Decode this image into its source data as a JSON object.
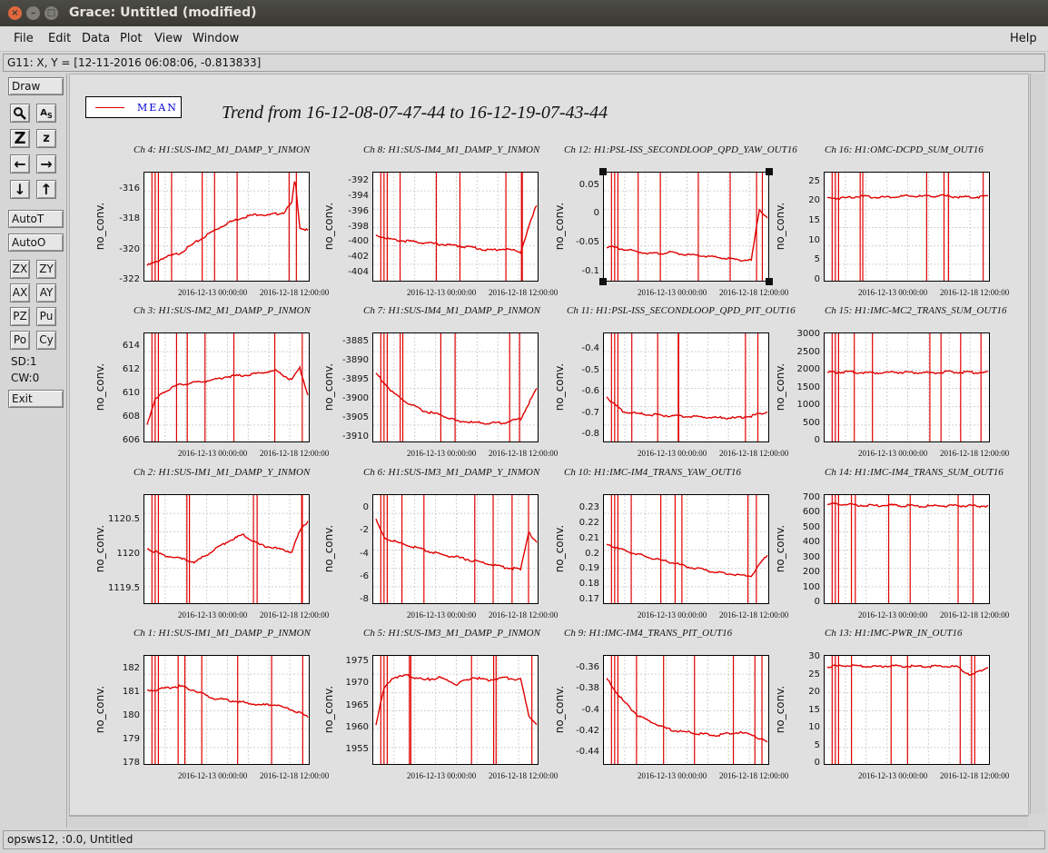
{
  "window": {
    "title": "Grace: Untitled (modified)"
  },
  "menu": {
    "file": "File",
    "edit": "Edit",
    "data": "Data",
    "plot": "Plot",
    "view": "View",
    "window": "Window",
    "help": "Help"
  },
  "locator": "G11: X, Y = [12-11-2016 06:08:06, -0.813833]",
  "toolbar": {
    "draw": "Draw",
    "autot": "AutoT",
    "autoo": "AutoO",
    "zx": "ZX",
    "zy": "ZY",
    "ax": "AX",
    "ay": "AY",
    "pz": "PZ",
    "pu": "Pu",
    "po": "Po",
    "cy": "Cy",
    "sd": "SD:1",
    "cw": "CW:0",
    "exit": "Exit",
    "icons": [
      "magnifier-icon",
      "text-as-icon",
      "zoom-z-icon",
      "zoom-z-small-icon",
      "arrow-left-icon",
      "arrow-right-icon",
      "arrow-down-icon",
      "arrow-up-icon"
    ]
  },
  "status": "opsws12, :0.0, Untitled",
  "legend": {
    "label": "MEAN",
    "color": "#e00000"
  },
  "main_title": "Trend from 16-12-08-07-47-44 to 16-12-19-07-43-44",
  "xticks": [
    "2016-12-13 00:00:00",
    "2016-12-18 12:00:00"
  ],
  "ylabel": "no_conv.",
  "ylabel_alt": "no_conv.",
  "chart_data": [
    {
      "type": "line",
      "title": "Ch 4: H1:SUS-IM2_M1_DAMP_Y_INMON",
      "yticks": [
        "-316",
        "-318",
        "-320",
        "-322"
      ],
      "ylim": [
        -322,
        -315
      ],
      "x": [
        0,
        0.05,
        0.1,
        0.2,
        0.3,
        0.4,
        0.5,
        0.6,
        0.7,
        0.75,
        0.8,
        0.85,
        0.9,
        0.92,
        0.95,
        1.0
      ],
      "y": [
        -321,
        -320.8,
        -320.5,
        -320.2,
        -319.5,
        -318.8,
        -318.2,
        -317.8,
        -317.6,
        -317.7,
        -317.6,
        -317.5,
        -316.9,
        -315.2,
        -318.5,
        -318.7
      ]
    },
    {
      "type": "line",
      "title": "Ch 8: H1:SUS-IM4_M1_DAMP_Y_INMON",
      "yticks": [
        "-392",
        "-394",
        "-396",
        "-398",
        "-400",
        "-402",
        "-404"
      ],
      "ylim": [
        -405,
        -391
      ],
      "x": [
        0,
        0.1,
        0.2,
        0.3,
        0.4,
        0.5,
        0.6,
        0.7,
        0.8,
        0.9,
        0.95,
        1.0
      ],
      "y": [
        -399,
        -399.6,
        -399.8,
        -400,
        -400.2,
        -400.4,
        -400.6,
        -401,
        -400.8,
        -401.2,
        -398,
        -395
      ]
    },
    {
      "type": "line",
      "title": "Ch 12: H1:PSL-ISS_SECONDLOOP_QPD_YAW_OUT16",
      "yticks": [
        "0.05",
        "0",
        "-0.05",
        "-0.1"
      ],
      "ylim": [
        -0.115,
        0.07
      ],
      "x": [
        0,
        0.1,
        0.2,
        0.3,
        0.4,
        0.5,
        0.6,
        0.7,
        0.8,
        0.9,
        0.95,
        1.0
      ],
      "y": [
        -0.055,
        -0.06,
        -0.065,
        -0.068,
        -0.066,
        -0.07,
        -0.072,
        -0.075,
        -0.078,
        -0.08,
        0.01,
        -0.005
      ]
    },
    {
      "type": "line",
      "title": "Ch 16: H1:OMC-DCPD_SUM_OUT16",
      "yticks": [
        "25",
        "20",
        "15",
        "10",
        "5",
        "0"
      ],
      "ylim": [
        0,
        27
      ],
      "x": [
        0,
        0.1,
        0.2,
        0.3,
        0.4,
        0.5,
        0.6,
        0.7,
        0.8,
        0.9,
        1.0
      ],
      "y": [
        21,
        21,
        21.5,
        21.2,
        21.3,
        21.5,
        21.4,
        21.6,
        21.3,
        21.2,
        21.5
      ]
    },
    {
      "type": "line",
      "title": "Ch 3: H1:SUS-IM2_M1_DAMP_P_INMON",
      "yticks": [
        "614",
        "612",
        "610",
        "608",
        "606"
      ],
      "ylim": [
        606,
        615
      ],
      "x": [
        0,
        0.05,
        0.1,
        0.2,
        0.3,
        0.4,
        0.5,
        0.6,
        0.7,
        0.8,
        0.9,
        0.95,
        1.0
      ],
      "y": [
        607.5,
        609.5,
        610.2,
        610.8,
        611,
        611.2,
        611.5,
        611.6,
        611.8,
        612,
        611.2,
        612.2,
        610
      ]
    },
    {
      "type": "line",
      "title": "Ch 7: H1:SUS-IM4_M1_DAMP_P_INMON",
      "yticks": [
        "-3885",
        "-3890",
        "-3895",
        "-3900",
        "-3905",
        "-3910"
      ],
      "ylim": [
        -3911,
        -3883
      ],
      "x": [
        0,
        0.1,
        0.2,
        0.3,
        0.4,
        0.5,
        0.6,
        0.7,
        0.8,
        0.9,
        1.0
      ],
      "y": [
        -3893,
        -3898,
        -3901,
        -3903,
        -3904,
        -3905.5,
        -3906,
        -3906.2,
        -3906,
        -3905,
        -3897
      ]
    },
    {
      "type": "line",
      "title": "Ch 11: H1:PSL-ISS_SECONDLOOP_QPD_PIT_OUT16",
      "yticks": [
        "-0.4",
        "-0.5",
        "-0.6",
        "-0.7",
        "-0.8"
      ],
      "ylim": [
        -0.83,
        -0.33
      ],
      "x": [
        0,
        0.1,
        0.2,
        0.3,
        0.4,
        0.5,
        0.6,
        0.7,
        0.8,
        0.9,
        1.0
      ],
      "y": [
        -0.62,
        -0.69,
        -0.7,
        -0.705,
        -0.71,
        -0.712,
        -0.715,
        -0.718,
        -0.72,
        -0.71,
        -0.69
      ]
    },
    {
      "type": "line",
      "title": "Ch 15: H1:IMC-MC2_TRANS_SUM_OUT16",
      "yticks": [
        "3000",
        "2500",
        "2000",
        "1500",
        "1000",
        "500",
        "0"
      ],
      "ylim": [
        0,
        3000
      ],
      "x": [
        0,
        0.1,
        0.2,
        0.3,
        0.4,
        0.5,
        0.6,
        0.7,
        0.8,
        0.9,
        1.0
      ],
      "y": [
        1950,
        1960,
        1950,
        1940,
        1960,
        1950,
        1940,
        1950,
        1960,
        1950,
        1950
      ]
    },
    {
      "type": "line",
      "title": "Ch 2: H1:SUS-IM1_M1_DAMP_Y_INMON",
      "yticks": [
        "1120.5",
        "1120",
        "1119.5"
      ],
      "ylim": [
        1119.3,
        1120.85
      ],
      "x": [
        0,
        0.1,
        0.2,
        0.3,
        0.4,
        0.5,
        0.6,
        0.7,
        0.8,
        0.9,
        0.95,
        1.0
      ],
      "y": [
        1120.1,
        1120,
        1119.95,
        1119.9,
        1120.05,
        1120.2,
        1120.3,
        1120.15,
        1120.1,
        1120.05,
        1120.35,
        1120.5
      ]
    },
    {
      "type": "line",
      "title": "Ch 6: H1:SUS-IM3_M1_DAMP_Y_INMON",
      "yticks": [
        "0",
        "-2",
        "-4",
        "-6",
        "-8"
      ],
      "ylim": [
        -8.2,
        1
      ],
      "x": [
        0,
        0.05,
        0.1,
        0.2,
        0.3,
        0.4,
        0.5,
        0.6,
        0.7,
        0.8,
        0.9,
        0.95,
        1.0
      ],
      "y": [
        -1,
        -2.5,
        -2.8,
        -3.2,
        -3.6,
        -4,
        -4.2,
        -4.5,
        -4.8,
        -5.1,
        -5.3,
        -2,
        -3
      ]
    },
    {
      "type": "line",
      "title": "Ch 10: H1:IMC-IM4_TRANS_YAW_OUT16",
      "yticks": [
        "0.23",
        "0.22",
        "0.21",
        "0.2",
        "0.19",
        "0.18",
        "0.17"
      ],
      "ylim": [
        0.168,
        0.238
      ],
      "x": [
        0,
        0.1,
        0.2,
        0.3,
        0.4,
        0.5,
        0.6,
        0.7,
        0.8,
        0.9,
        1.0
      ],
      "y": [
        0.207,
        0.203,
        0.2,
        0.197,
        0.195,
        0.192,
        0.19,
        0.188,
        0.187,
        0.186,
        0.2
      ]
    },
    {
      "type": "line",
      "title": "Ch 14: H1:IMC-IM4_TRANS_SUM_OUT16",
      "yticks": [
        "700",
        "600",
        "500",
        "400",
        "300",
        "200",
        "100",
        "0"
      ],
      "ylim": [
        0,
        710
      ],
      "x": [
        0,
        0.1,
        0.2,
        0.3,
        0.4,
        0.5,
        0.6,
        0.7,
        0.8,
        0.9,
        1.0
      ],
      "y": [
        660,
        660,
        655,
        650,
        655,
        650,
        648,
        650,
        652,
        648,
        650
      ]
    },
    {
      "type": "line",
      "title": "Ch 1: H1:SUS-IM1_M1_DAMP_P_INMON",
      "yticks": [
        "182",
        "181",
        "180",
        "179",
        "178"
      ],
      "ylim": [
        178,
        182.5
      ],
      "x": [
        0,
        0.1,
        0.2,
        0.3,
        0.4,
        0.5,
        0.6,
        0.7,
        0.8,
        0.9,
        1.0
      ],
      "y": [
        181.1,
        181.2,
        181.3,
        181.1,
        180.8,
        180.7,
        180.6,
        180.5,
        180.5,
        180.3,
        180
      ]
    },
    {
      "type": "line",
      "title": "Ch 5: H1:SUS-IM3_M1_DAMP_P_INMON",
      "yticks": [
        "1975",
        "1970",
        "1965",
        "1960",
        "1955"
      ],
      "ylim": [
        1952,
        1976
      ],
      "x": [
        0,
        0.05,
        0.1,
        0.2,
        0.3,
        0.4,
        0.5,
        0.6,
        0.7,
        0.8,
        0.9,
        0.95,
        1.0
      ],
      "y": [
        1961,
        1969,
        1971.5,
        1972,
        1971,
        1971.5,
        1970,
        1971.5,
        1971,
        1971.5,
        1971,
        1963,
        1961
      ]
    },
    {
      "type": "line",
      "title": "Ch 9: H1:IMC-IM4_TRANS_PIT_OUT16",
      "yticks": [
        "-0.36",
        "-0.38",
        "-0.4",
        "-0.42",
        "-0.44"
      ],
      "ylim": [
        -0.45,
        -0.35
      ],
      "x": [
        0,
        0.1,
        0.2,
        0.3,
        0.4,
        0.5,
        0.6,
        0.7,
        0.8,
        0.9,
        1.0
      ],
      "y": [
        -0.37,
        -0.39,
        -0.405,
        -0.412,
        -0.418,
        -0.42,
        -0.422,
        -0.423,
        -0.42,
        -0.422,
        -0.43
      ]
    },
    {
      "type": "line",
      "title": "Ch 13: H1:IMC-PWR_IN_OUT16",
      "yticks": [
        "30",
        "25",
        "20",
        "15",
        "10",
        "5",
        "0"
      ],
      "ylim": [
        0,
        30
      ],
      "x": [
        0,
        0.1,
        0.2,
        0.3,
        0.4,
        0.5,
        0.6,
        0.7,
        0.8,
        0.9,
        1.0
      ],
      "y": [
        27.5,
        27.8,
        27.6,
        27.5,
        27.7,
        27.6,
        27.5,
        27.6,
        27.4,
        25,
        27.5
      ]
    }
  ]
}
